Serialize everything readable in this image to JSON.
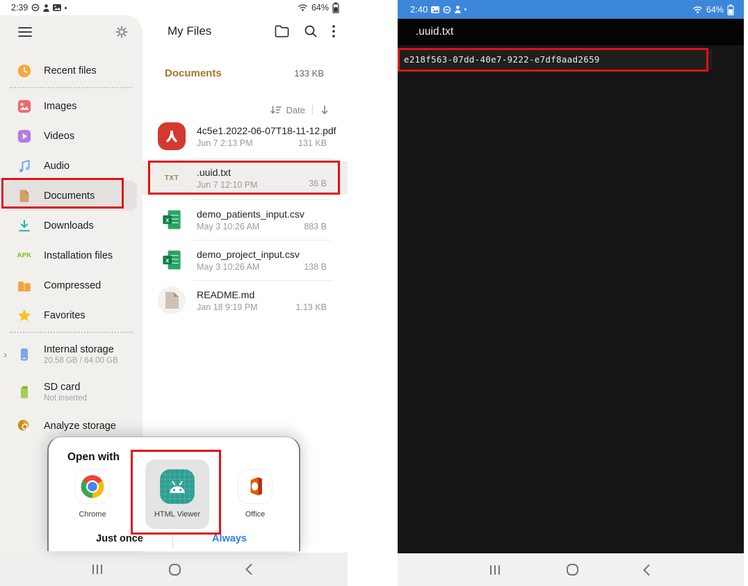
{
  "colors": {
    "annotation_red": "#e01216",
    "accent_blue": "#2d7ff0",
    "folder_gold": "#a5762c",
    "statusbar_blue": "#3c86dc"
  },
  "left_phone": {
    "status_bar": {
      "time": "2:39",
      "battery_percent": "64%"
    },
    "sidebar": {
      "items": [
        {
          "label": "Recent files"
        },
        {
          "label": "Images"
        },
        {
          "label": "Videos"
        },
        {
          "label": "Audio"
        },
        {
          "label": "Documents",
          "selected": true
        },
        {
          "label": "Downloads"
        },
        {
          "label": "Installation files",
          "badge": "APK"
        },
        {
          "label": "Compressed"
        },
        {
          "label": "Favorites"
        },
        {
          "label": "Internal storage",
          "subtitle": "20.58 GB / 64.00 GB"
        },
        {
          "label": "SD card",
          "subtitle": "Not inserted"
        },
        {
          "label": "Analyze storage"
        }
      ]
    },
    "app_bar": {
      "title": "My Files"
    },
    "file_list": {
      "folder_name": "Documents",
      "folder_size": "133 KB",
      "sort_by": "Date",
      "files": [
        {
          "name": "4c5e1.2022-06-07T18-11-12.pdf",
          "date": "Jun 7 2:13 PM",
          "size": "131 KB"
        },
        {
          "name": ".uuid.txt",
          "date": "Jun 7 12:10 PM",
          "size": "36 B",
          "badge": "TXT",
          "selected": true
        },
        {
          "name": "demo_patients_input.csv",
          "date": "May 3 10:26 AM",
          "size": "883 B"
        },
        {
          "name": "demo_project_input.csv",
          "date": "May 3 10:26 AM",
          "size": "138 B"
        },
        {
          "name": "README.md",
          "date": "Jan 18 9:19 PM",
          "size": "1.13 KB"
        }
      ]
    },
    "open_with_dialog": {
      "title": "Open with",
      "apps": [
        {
          "label": "Chrome"
        },
        {
          "label": "HTML Viewer",
          "selected": true
        },
        {
          "label": "Office"
        }
      ],
      "just_once_label": "Just once",
      "always_label": "Always"
    }
  },
  "right_phone": {
    "status_bar": {
      "time": "2:40",
      "battery_percent": "64%"
    },
    "app_bar": {
      "title": ".uuid.txt"
    },
    "file_content": "e218f563-07dd-40e7-9222-e7df8aad2659"
  }
}
